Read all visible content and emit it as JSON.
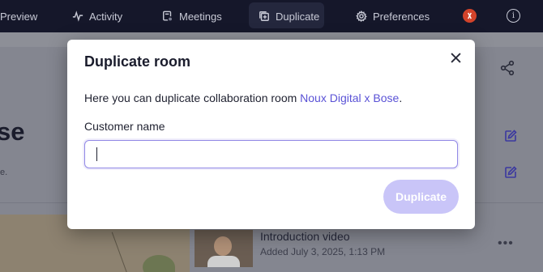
{
  "nav": {
    "items": [
      {
        "label": "Preview",
        "icon": "preview-icon"
      },
      {
        "label": "Activity",
        "icon": "activity-icon"
      },
      {
        "label": "Meetings",
        "icon": "meetings-icon"
      },
      {
        "label": "Duplicate",
        "icon": "duplicate-icon",
        "active": true
      },
      {
        "label": "Preferences",
        "icon": "gear-icon"
      }
    ],
    "avatar_color": "#d2432a",
    "info_glyph": "i"
  },
  "background": {
    "room_title_fragment": "se",
    "sub_fragment": "e.",
    "video": {
      "title": "Introduction video",
      "meta": "Added July 3, 2025, 1:13 PM"
    }
  },
  "modal": {
    "title": "Duplicate room",
    "description_prefix": "Here you can duplicate collaboration room ",
    "room_link": "Noux Digital x Bose",
    "description_suffix": ".",
    "field_label": "Customer name",
    "input_value": "",
    "input_placeholder": "",
    "button_label": "Duplicate",
    "colors": {
      "accent": "#5a52d6",
      "button_disabled_bg": "#c9c5f8",
      "input_border": "#9289e6"
    }
  }
}
